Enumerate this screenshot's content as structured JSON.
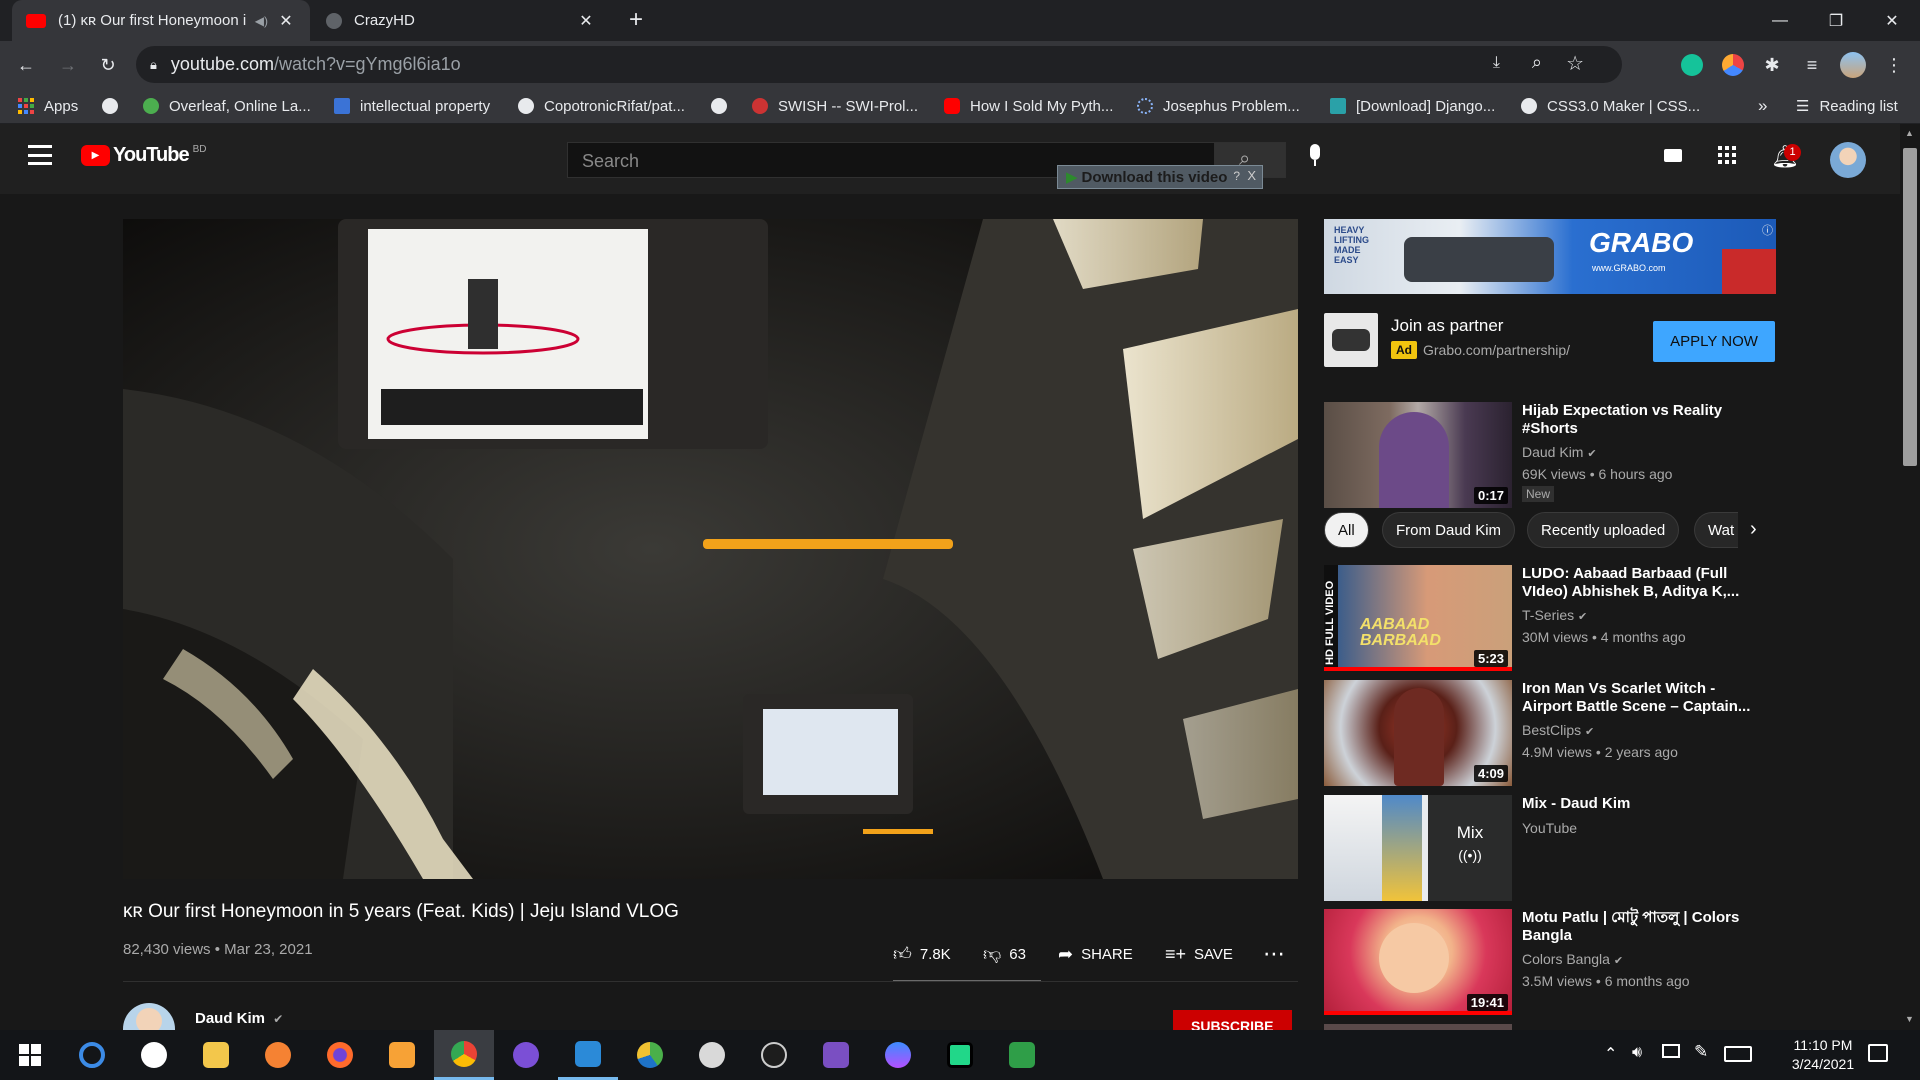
{
  "browser": {
    "tabs": [
      {
        "title": "(1) ĸʀ Our first Honeymoon i",
        "active": true
      },
      {
        "title": "CrazyHD",
        "active": false
      }
    ],
    "new_tab_label": "+",
    "url_host": "youtube.com",
    "url_path": "/watch?v=gYmg6l6ia1o",
    "bookmarks": [
      "Apps",
      "",
      "Overleaf, Online La...",
      "intellectual property",
      "CopotronicRifat/pat...",
      "",
      "SWISH -- SWI-Prol...",
      "How I Sold My Pyth...",
      "Josephus Problem...",
      "[Download] Django...",
      "CSS3.0 Maker | CSS..."
    ],
    "bookmarks_overflow": "»",
    "reading_list": "Reading list"
  },
  "youtube": {
    "logo_text": "YouTube",
    "country": "BD",
    "search_placeholder": "Search",
    "download_pill": "Download this video",
    "download_pill_help": "?",
    "download_pill_close": "X",
    "notification_count": "1",
    "video": {
      "title": "ĸʀ Our first Honeymoon in 5 years (Feat. Kids) | Jeju Island VLOG",
      "views": "82,430 views",
      "date": "Mar 23, 2021",
      "likes": "7.8K",
      "dislikes": "63",
      "share": "SHARE",
      "save": "SAVE",
      "channel": "Daud Kim",
      "subscribe": "SUBSCRIBE"
    },
    "ad": {
      "title": "Join as partner",
      "badge": "Ad",
      "domain": "Grabo.com/partnership/",
      "cta": "APPLY NOW",
      "banner_brand": "GRABO",
      "banner_tagline_1": "HEAVY",
      "banner_tagline_2": "LIFTING",
      "banner_tagline_3": "MADE",
      "banner_tagline_4": "EASY",
      "banner_url": "www.GRABO.com"
    },
    "first_rec": {
      "title_1": "Hijab Expectation vs Reality",
      "title_2": "#Shorts",
      "channel": "Daud Kim",
      "meta": "69K views • 6 hours ago",
      "badge": "New",
      "duration": "0:17"
    },
    "chips": [
      "All",
      "From Daud Kim",
      "Recently uploaded",
      "Wat"
    ],
    "recs": [
      {
        "title_1": "LUDO: Aabaad Barbaad (Full",
        "title_2": "VIdeo) Abhishek B, Aditya K,...",
        "channel": "T-Series",
        "meta": "30M views • 4 months ago",
        "duration": "5:23",
        "thumb_text": "AABAAD BARBAAD",
        "side_text": "HD FULL VIDEO"
      },
      {
        "title_1": "Iron Man Vs Scarlet Witch -",
        "title_2": "Airport Battle Scene – Captain...",
        "channel": "BestClips",
        "meta": "4.9M views • 2 years ago",
        "duration": "4:09"
      },
      {
        "title_1": "Mix - Daud Kim",
        "title_2": "",
        "channel": "YouTube",
        "meta": "",
        "duration": "",
        "mix_label": "Mix",
        "mix_icon": "((•))"
      },
      {
        "title_1": "Motu Patlu | মোটু পাতলু | Colors",
        "title_2": "Bangla",
        "channel": "Colors Bangla",
        "meta": "3.5M views • 6 months ago",
        "duration": "19:41"
      }
    ]
  },
  "taskbar": {
    "time": "11:10 PM",
    "date": "3/24/2021"
  }
}
